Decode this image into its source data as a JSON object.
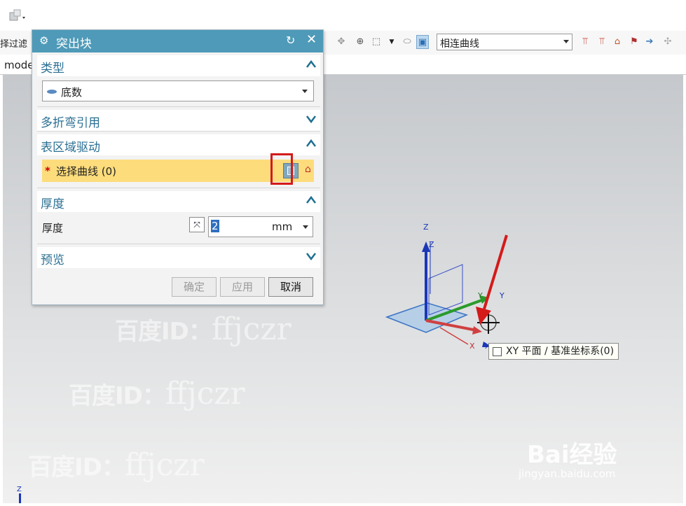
{
  "toolbar": {
    "filter_label": "择过滤",
    "curve_rule": "相连曲线"
  },
  "tab": {
    "label": "mode"
  },
  "dialog": {
    "title": "突出块",
    "sections": {
      "type": {
        "header": "类型",
        "value": "底数"
      },
      "multibend": {
        "header": "多折弯引用"
      },
      "surface": {
        "header": "表区域驱动",
        "curve_label": "选择曲线 (0)",
        "required_mark": "*"
      },
      "thickness": {
        "header": "厚度",
        "label": "厚度",
        "value": "2",
        "unit": "mm"
      },
      "preview": {
        "header": "预览"
      }
    },
    "buttons": {
      "ok": "确定",
      "apply": "应用",
      "cancel": "取消"
    }
  },
  "viewport": {
    "tooltip": "XY 平面 / 基准坐标系(0)",
    "axis_labels": {
      "z1": "Z",
      "z2": "Z",
      "y1": "Y",
      "y2": "Y",
      "x1": "X",
      "x2": "X",
      "corner_z": "Z"
    },
    "watermark": {
      "cn": "百度ID：",
      "id": "ffjczr"
    },
    "logo": "Bai经验",
    "logo_url": "jingyan.baidu.com"
  }
}
